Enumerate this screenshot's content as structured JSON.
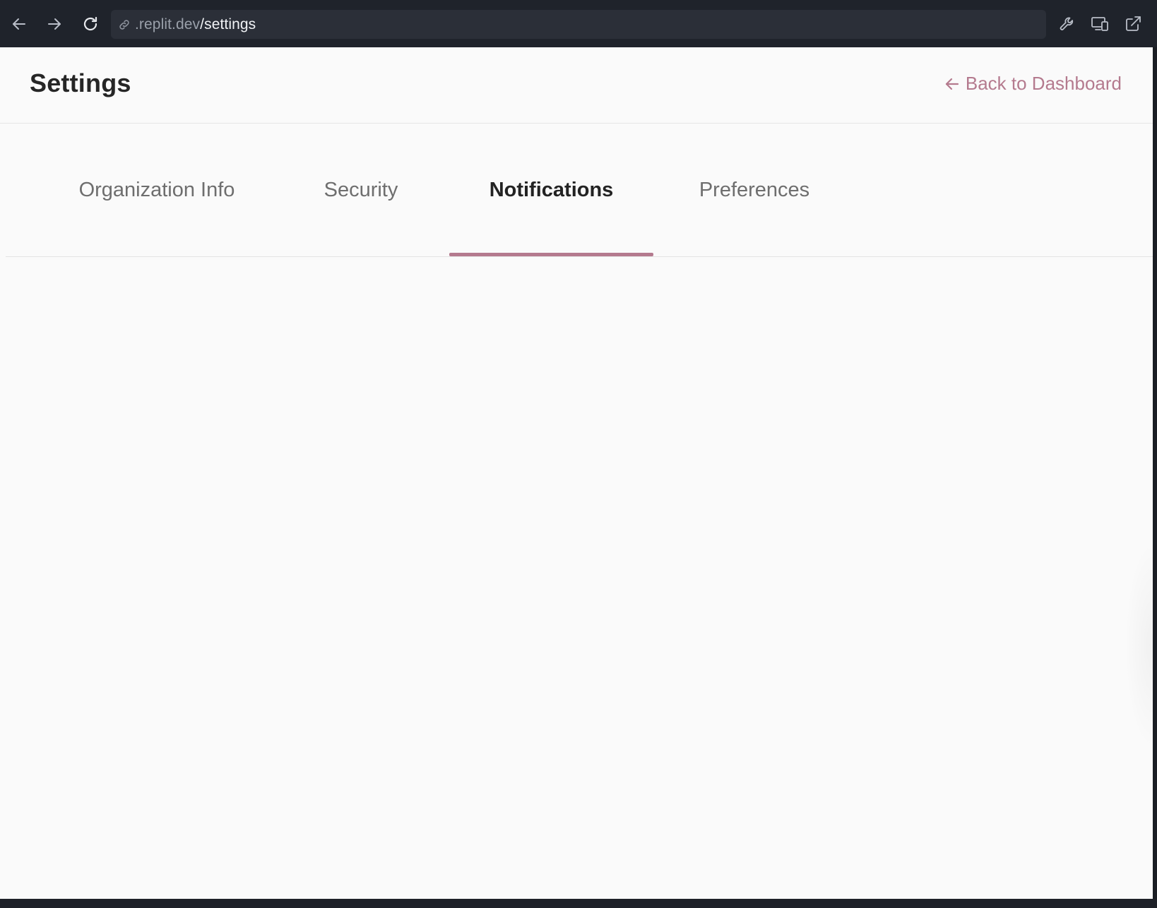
{
  "browser": {
    "url_host": ".replit.dev",
    "url_path": "/settings",
    "icons": {
      "back": "arrow-left-icon",
      "forward": "arrow-right-icon",
      "reload": "reload-icon",
      "link": "link-icon",
      "wrench": "wrench-icon",
      "devices": "devices-icon",
      "external": "external-link-icon"
    }
  },
  "header": {
    "title": "Settings",
    "back_label": "Back to Dashboard",
    "back_icon": "arrow-left-icon"
  },
  "tabs": [
    {
      "label": "Organization Info",
      "active": false
    },
    {
      "label": "Security",
      "active": false
    },
    {
      "label": "Notifications",
      "active": true
    },
    {
      "label": "Preferences",
      "active": false
    }
  ],
  "colors": {
    "accent": "#b47a8e",
    "chrome_bg": "#1f232b",
    "page_bg": "#fafafa",
    "title_text": "#262626",
    "tab_inactive": "#6e6e6e"
  }
}
